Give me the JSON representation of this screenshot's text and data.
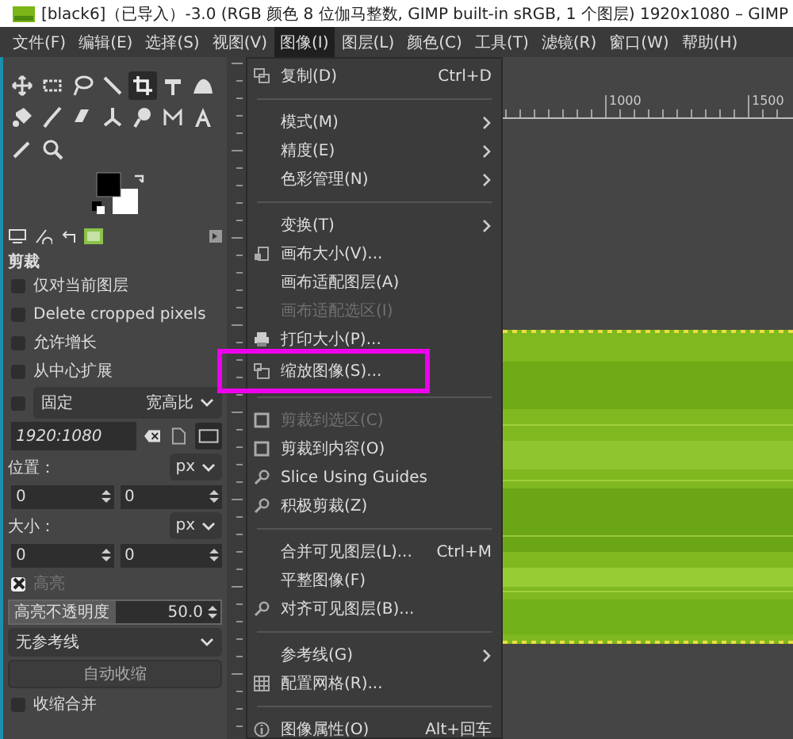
{
  "window": {
    "title": "[black6]（已导入）-3.0 (RGB 颜色 8 位伽马整数, GIMP built-in sRGB, 1 个图层) 1920x1080 – GIMP"
  },
  "menubar": [
    {
      "label": "文件(F)",
      "selected": false
    },
    {
      "label": "编辑(E)",
      "selected": false
    },
    {
      "label": "选择(S)",
      "selected": false
    },
    {
      "label": "视图(V)",
      "selected": false
    },
    {
      "label": "图像(I)",
      "selected": true
    },
    {
      "label": "图层(L)",
      "selected": false
    },
    {
      "label": "颜色(C)",
      "selected": false
    },
    {
      "label": "工具(T)",
      "selected": false
    },
    {
      "label": "滤镜(R)",
      "selected": false
    },
    {
      "label": "窗口(W)",
      "selected": false
    },
    {
      "label": "帮助(H)",
      "selected": false
    }
  ],
  "toolbox": {
    "tools": [
      {
        "selected": false
      },
      {
        "selected": false
      },
      {
        "selected": false
      },
      {
        "selected": false
      },
      {
        "selected": true
      },
      {
        "selected": false
      },
      {
        "selected": false
      },
      {
        "selected": false
      },
      {
        "selected": false
      },
      {
        "selected": false
      },
      {
        "selected": false
      },
      {
        "selected": false
      },
      {
        "selected": false
      },
      {
        "selected": false
      },
      {
        "selected": false
      },
      {
        "selected": false
      }
    ]
  },
  "tool_options": {
    "title": "剪裁",
    "options": [
      {
        "kind": "checkbox",
        "label": "仅对当前图层",
        "checked": false,
        "disabled": false
      },
      {
        "kind": "checkbox",
        "label": "Delete cropped pixels",
        "checked": false,
        "disabled": false
      },
      {
        "kind": "checkbox",
        "label": "允许增长",
        "checked": false,
        "disabled": false
      },
      {
        "kind": "checkbox",
        "label": "从中心扩展",
        "checked": false,
        "disabled": false
      },
      {
        "kind": "fixed",
        "label": "固定",
        "checked": false,
        "value": "宽高比"
      },
      {
        "kind": "text",
        "value": "1920:1080"
      },
      {
        "kind": "unit",
        "label": "位置：",
        "value": "px"
      },
      {
        "kind": "spin-pair",
        "values": [
          "0",
          "0"
        ]
      },
      {
        "kind": "unit",
        "label": "大小：",
        "value": "px"
      },
      {
        "kind": "spin-pair",
        "values": [
          "0",
          "0"
        ]
      },
      {
        "kind": "checkbox",
        "label": "高亮",
        "checked": true,
        "disabled": true
      },
      {
        "kind": "slider",
        "label": "高亮不透明度",
        "reading": "50.0",
        "level": 0.5
      },
      {
        "kind": "dropdown",
        "value": "无参考线"
      },
      {
        "kind": "button",
        "label": "自动收缩"
      },
      {
        "kind": "checkbox",
        "label": "收缩合并",
        "checked": false,
        "disabled": false
      }
    ]
  },
  "ruler": {
    "labels": [
      "1000",
      "1500"
    ]
  },
  "image_menu": {
    "items": [
      {
        "kind": "item",
        "label": "复制(D)",
        "shortcut": "Ctrl+D",
        "submenu": false,
        "disabled": false,
        "highlighted": false
      },
      {
        "kind": "separator"
      },
      {
        "kind": "item",
        "label": "模式(M)",
        "submenu": true,
        "disabled": false,
        "highlighted": false
      },
      {
        "kind": "item",
        "label": "精度(E)",
        "submenu": true,
        "disabled": false,
        "highlighted": false
      },
      {
        "kind": "item",
        "label": "色彩管理(N)",
        "submenu": true,
        "disabled": false,
        "highlighted": false
      },
      {
        "kind": "separator"
      },
      {
        "kind": "item",
        "label": "变换(T)",
        "submenu": true,
        "disabled": false,
        "highlighted": false
      },
      {
        "kind": "item",
        "label": "画布大小(V)...",
        "submenu": false,
        "disabled": false,
        "highlighted": false
      },
      {
        "kind": "item",
        "label": "画布适配图层(A)",
        "submenu": false,
        "disabled": false,
        "highlighted": false
      },
      {
        "kind": "item",
        "label": "画布适配选区(I)",
        "submenu": false,
        "disabled": true,
        "highlighted": false
      },
      {
        "kind": "item",
        "label": "打印大小(P)...",
        "submenu": false,
        "disabled": false,
        "highlighted": false
      },
      {
        "kind": "item",
        "label": "缩放图像(S)...",
        "submenu": false,
        "disabled": false,
        "highlighted": true
      },
      {
        "kind": "separator"
      },
      {
        "kind": "item",
        "label": "剪裁到选区(C)",
        "submenu": false,
        "disabled": true,
        "highlighted": false
      },
      {
        "kind": "item",
        "label": "剪裁到内容(O)",
        "submenu": false,
        "disabled": false,
        "highlighted": false
      },
      {
        "kind": "item",
        "label": "Slice Using Guides",
        "submenu": false,
        "disabled": false,
        "highlighted": false
      },
      {
        "kind": "item",
        "label": "积极剪裁(Z)",
        "submenu": false,
        "disabled": false,
        "highlighted": false
      },
      {
        "kind": "separator"
      },
      {
        "kind": "item",
        "label": "合并可见图层(L)...",
        "shortcut": "Ctrl+M",
        "submenu": false,
        "disabled": false,
        "highlighted": false
      },
      {
        "kind": "item",
        "label": "平整图像(F)",
        "submenu": false,
        "disabled": false,
        "highlighted": false
      },
      {
        "kind": "item",
        "label": "对齐可见图层(B)...",
        "submenu": false,
        "disabled": false,
        "highlighted": false
      },
      {
        "kind": "separator"
      },
      {
        "kind": "item",
        "label": "参考线(G)",
        "submenu": true,
        "disabled": false,
        "highlighted": false
      },
      {
        "kind": "item",
        "label": "配置网格(R)...",
        "submenu": false,
        "disabled": false,
        "highlighted": false
      },
      {
        "kind": "separator"
      },
      {
        "kind": "item",
        "label": "图像属性(O)",
        "shortcut": "Alt+回车",
        "submenu": false,
        "disabled": false,
        "highlighted": false
      }
    ]
  }
}
